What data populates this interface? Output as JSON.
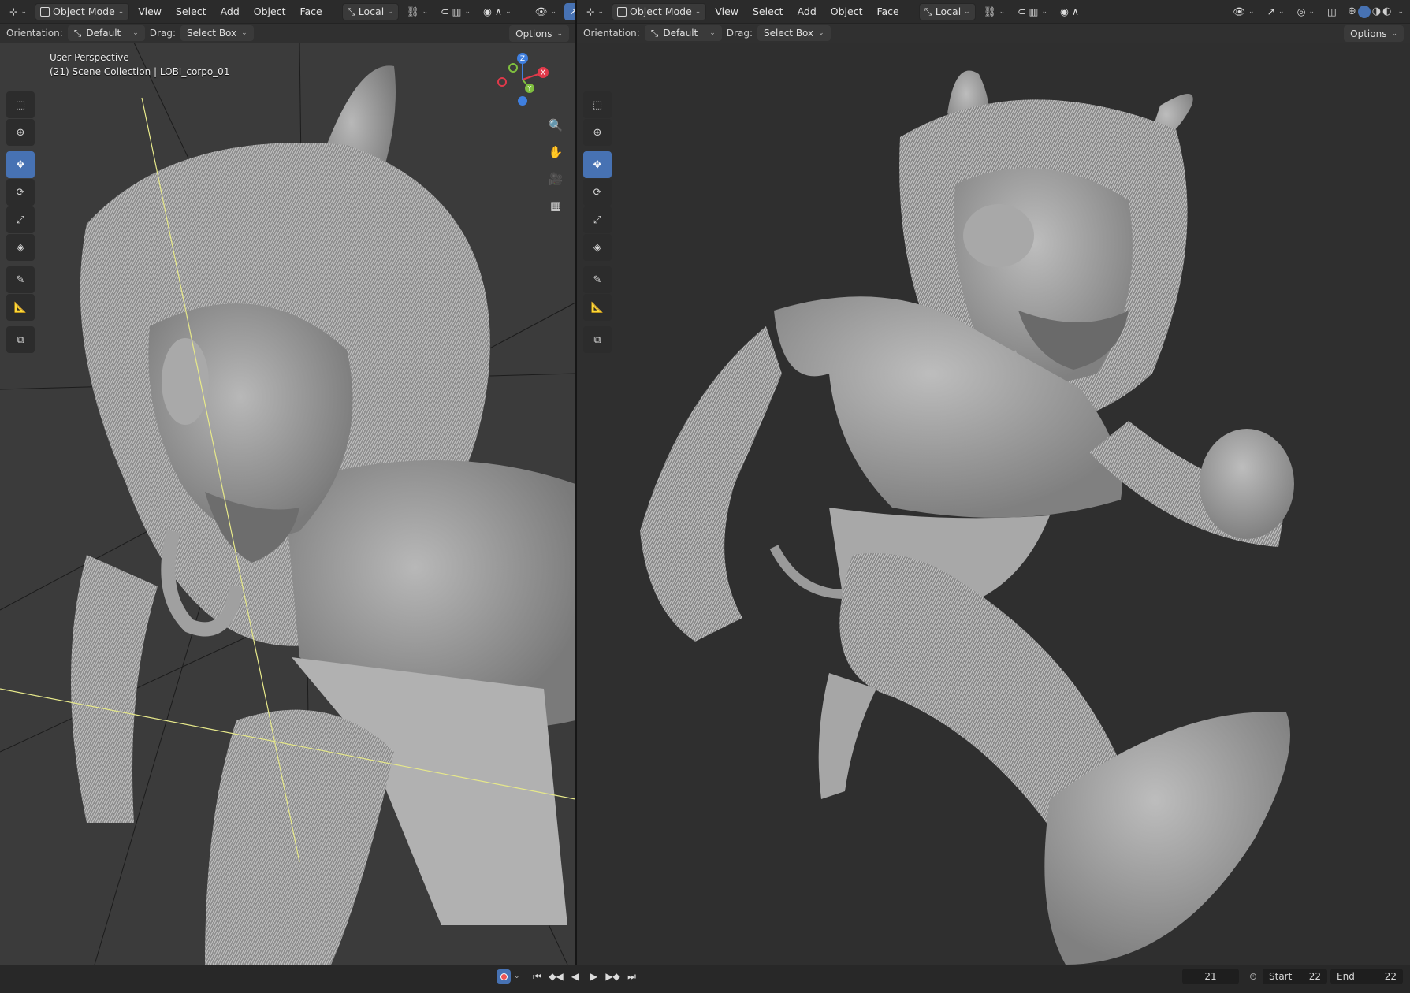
{
  "left_editor": {
    "header": {
      "mode": "Object Mode",
      "menus": [
        "View",
        "Select",
        "Add",
        "Object",
        "Face"
      ],
      "transform_space": "Local"
    },
    "subheader": {
      "orientation_label": "Orientation:",
      "orientation_value": "Default",
      "drag_label": "Drag:",
      "drag_value": "Select Box",
      "options_label": "Options"
    },
    "overlay": {
      "view_name": "User Perspective",
      "collection": "(21) Scene Collection | LOBI_corpo_01"
    },
    "gizmo": {
      "z": "Z",
      "x": "X",
      "y": "Y"
    }
  },
  "right_editor": {
    "header": {
      "mode": "Object Mode",
      "menus": [
        "View",
        "Select",
        "Add",
        "Object",
        "Face"
      ],
      "transform_space": "Local"
    },
    "subheader": {
      "orientation_label": "Orientation:",
      "orientation_value": "Default",
      "drag_label": "Drag:",
      "drag_value": "Select Box",
      "options_label": "Options"
    }
  },
  "timeline": {
    "current_frame": "21",
    "start_label": "Start",
    "start_value": "22",
    "end_label": "End",
    "end_value": "22"
  },
  "colors": {
    "accent": "#4772b3",
    "axis_x": "#e0394a",
    "axis_y": "#7fbf3f",
    "axis_z": "#3f7fdf"
  }
}
